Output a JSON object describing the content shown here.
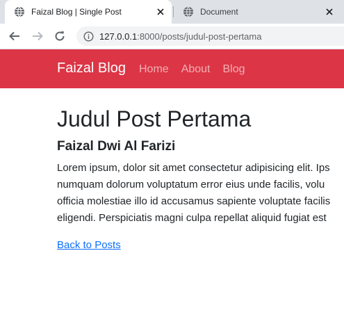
{
  "colors": {
    "navbar_bg": "#dc3545",
    "link": "#0d6efd",
    "tabstrip_bg": "#dee1e6"
  },
  "browser": {
    "tabs": [
      {
        "title": "Faizal Blog | Single Post",
        "icon": "globe-icon",
        "active": true
      },
      {
        "title": "Document",
        "icon": "globe-icon",
        "active": false
      }
    ],
    "address_host": "127.0.0.1",
    "address_path": ":8000/posts/judul-post-pertama"
  },
  "navbar": {
    "brand": "Faizal Blog",
    "links": [
      "Home",
      "About",
      "Blog"
    ]
  },
  "post": {
    "title": "Judul Post Pertama",
    "author": "Faizal Dwi Al Farizi",
    "body_lines": [
      "Lorem ipsum, dolor sit amet consectetur adipisicing elit. Ips",
      "numquam dolorum voluptatum error eius unde facilis, volu",
      "officia molestiae illo id accusamus sapiente voluptate facilis",
      "eligendi. Perspiciatis magni culpa repellat aliquid fugiat est"
    ],
    "back_link": "Back to Posts"
  }
}
